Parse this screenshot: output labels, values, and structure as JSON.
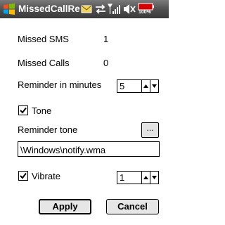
{
  "titlebar": {
    "title": "MissedCallRe",
    "battery": "100%"
  },
  "form": {
    "missed_sms_label": "Missed SMS",
    "missed_sms_value": "1",
    "missed_calls_label": "Missed Calls",
    "missed_calls_value": "0",
    "reminder_label": "Reminder in minutes",
    "reminder_value": "5",
    "tone_label": "Tone",
    "tone_checked": true,
    "reminder_tone_label": "Reminder tone",
    "browse_label": "...",
    "tone_path": "\\Windows\\notify.wma",
    "vibrate_label": "Vibrate",
    "vibrate_checked": true,
    "vibrate_value": "1"
  },
  "buttons": {
    "apply": "Apply",
    "cancel": "Cancel"
  }
}
